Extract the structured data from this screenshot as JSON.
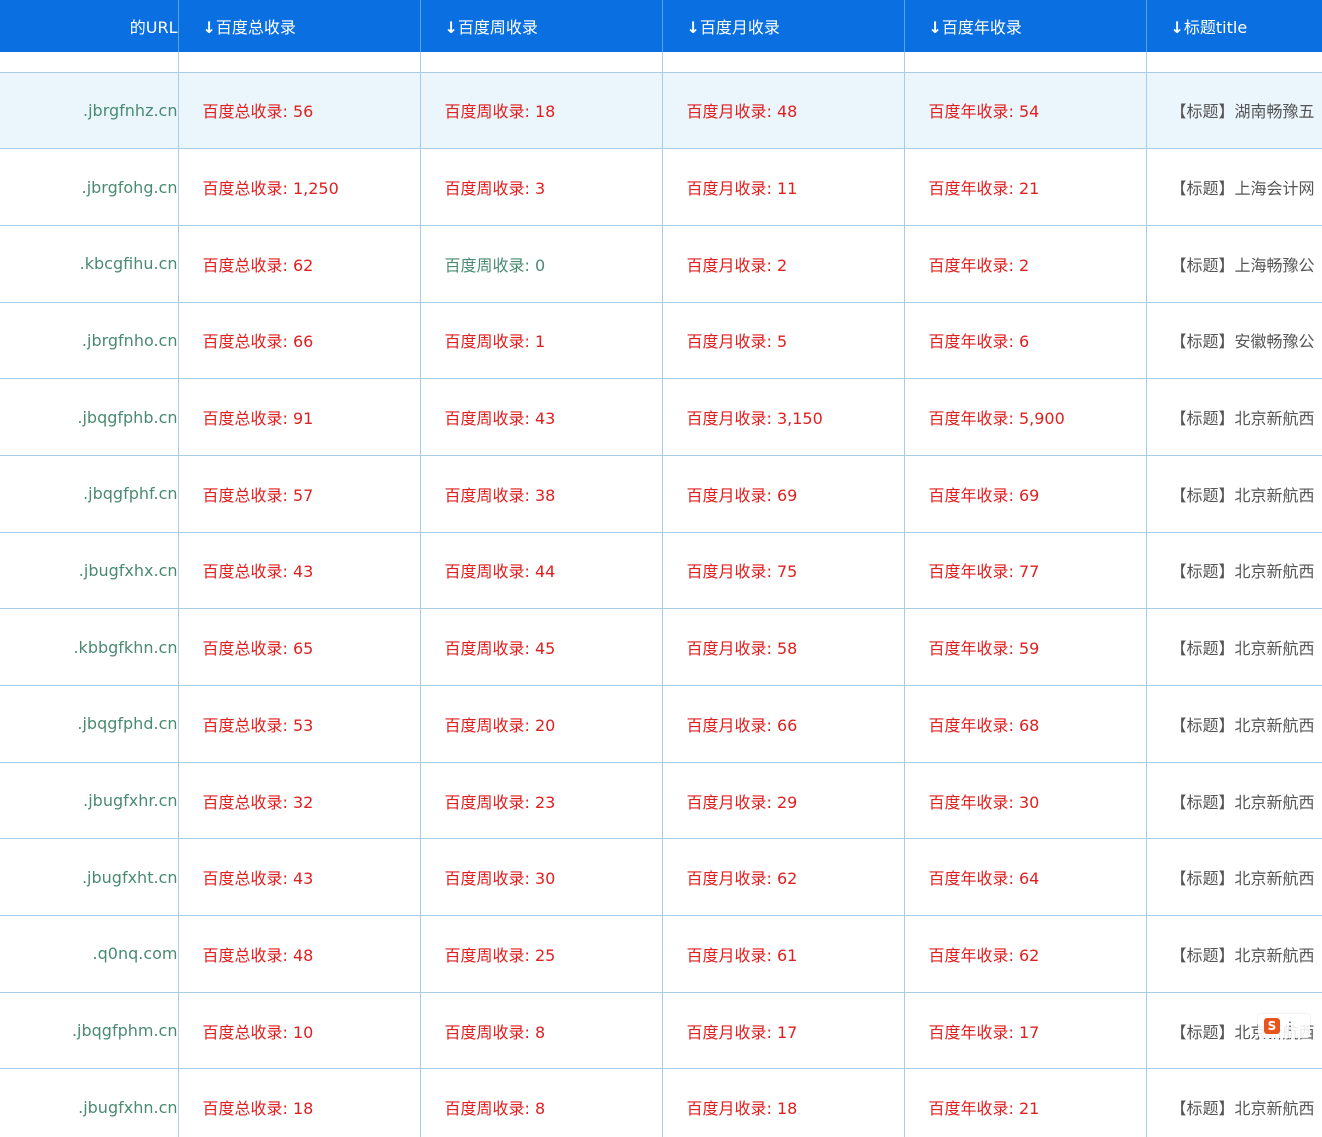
{
  "table": {
    "headers": [
      {
        "arrow": "",
        "label": "的URL"
      },
      {
        "arrow": "↓",
        "label": "百度总收录"
      },
      {
        "arrow": "↓",
        "label": "百度周收录"
      },
      {
        "arrow": "↓",
        "label": "百度月收录"
      },
      {
        "arrow": "↓",
        "label": "百度年收录"
      },
      {
        "arrow": "↓",
        "label": "标题title"
      }
    ],
    "rows": [
      {
        "url": ".jbrgfnhz.cn",
        "total": "百度总收录: 56",
        "week": "百度周收录: 18",
        "month": "百度月收录: 48",
        "year": "百度年收录: 54",
        "title": "【标题】湖南畅豫五"
      },
      {
        "url": ".jbrgfohg.cn",
        "total": "百度总收录: 1,250",
        "week": "百度周收录: 3",
        "month": "百度月收录: 11",
        "year": "百度年收录: 21",
        "title": "【标题】上海会计网"
      },
      {
        "url": ".kbcgfihu.cn",
        "total": "百度总收录: 62",
        "week": "百度周收录: 0",
        "month": "百度月收录: 2",
        "year": "百度年收录: 2",
        "title": "【标题】上海畅豫公"
      },
      {
        "url": ".jbrgfnho.cn",
        "total": "百度总收录: 66",
        "week": "百度周收录: 1",
        "month": "百度月收录: 5",
        "year": "百度年收录: 6",
        "title": "【标题】安徽畅豫公"
      },
      {
        "url": ".jbqgfphb.cn",
        "total": "百度总收录: 91",
        "week": "百度周收录: 43",
        "month": "百度月收录: 3,150",
        "year": "百度年收录: 5,900",
        "title": "【标题】北京新航西"
      },
      {
        "url": ".jbqgfphf.cn",
        "total": "百度总收录: 57",
        "week": "百度周收录: 38",
        "month": "百度月收录: 69",
        "year": "百度年收录: 69",
        "title": "【标题】北京新航西"
      },
      {
        "url": ".jbugfxhx.cn",
        "total": "百度总收录: 43",
        "week": "百度周收录: 44",
        "month": "百度月收录: 75",
        "year": "百度年收录: 77",
        "title": "【标题】北京新航西"
      },
      {
        "url": ".kbbgfkhn.cn",
        "total": "百度总收录: 65",
        "week": "百度周收录: 45",
        "month": "百度月收录: 58",
        "year": "百度年收录: 59",
        "title": "【标题】北京新航西"
      },
      {
        "url": ".jbqgfphd.cn",
        "total": "百度总收录: 53",
        "week": "百度周收录: 20",
        "month": "百度月收录: 66",
        "year": "百度年收录: 68",
        "title": "【标题】北京新航西"
      },
      {
        "url": ".jbugfxhr.cn",
        "total": "百度总收录: 32",
        "week": "百度周收录: 23",
        "month": "百度月收录: 29",
        "year": "百度年收录: 30",
        "title": "【标题】北京新航西"
      },
      {
        "url": ".jbugfxht.cn",
        "total": "百度总收录: 43",
        "week": "百度周收录: 30",
        "month": "百度月收录: 62",
        "year": "百度年收录: 64",
        "title": "【标题】北京新航西"
      },
      {
        "url": ".q0nq.com",
        "total": "百度总收录: 48",
        "week": "百度周收录: 25",
        "month": "百度月收录: 61",
        "year": "百度年收录: 62",
        "title": "【标题】北京新航西"
      },
      {
        "url": ".jbqgfphm.cn",
        "total": "百度总收录: 10",
        "week": "百度周收录: 8",
        "month": "百度月收录: 17",
        "year": "百度年收录: 17",
        "title": "【标题】北京新航西"
      },
      {
        "url": ".jbugfxhn.cn",
        "total": "百度总收录: 18",
        "week": "百度周收录: 8",
        "month": "百度月收录: 18",
        "year": "百度年收录: 21",
        "title": "【标题】北京新航西"
      }
    ],
    "highlighted_row": 0,
    "zero_cells": [
      {
        "row": 2,
        "col": "week"
      }
    ]
  },
  "badge": {
    "icon": "s-logo-icon",
    "glyph": "S",
    "dots": "⋮"
  },
  "colors": {
    "header_bg": "#0a6fe0",
    "value_text": "#e02020",
    "url_text": "#4a8a72",
    "row_highlight": "#eaf6fc",
    "grid_line": "#a9cde6"
  }
}
